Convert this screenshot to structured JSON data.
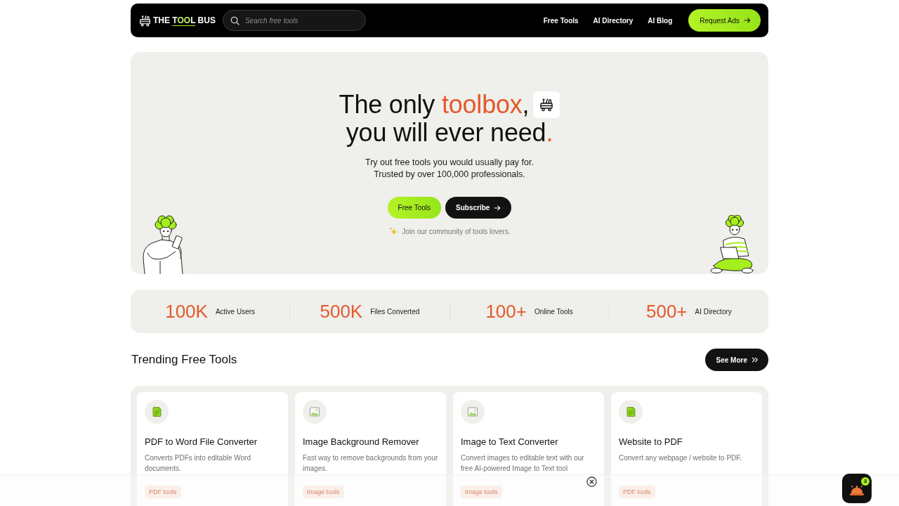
{
  "header": {
    "logo": [
      {
        "text": "THE ",
        "accent": false,
        "underline": false
      },
      {
        "text": "T",
        "accent": false,
        "underline": true
      },
      {
        "text": "OO",
        "accent": true,
        "underline": true
      },
      {
        "text": "L",
        "accent": false,
        "underline": true
      },
      {
        "text": " BUS",
        "accent": false,
        "underline": false
      }
    ],
    "search": {
      "placeholder": "Search free tools"
    },
    "nav": [
      "Free Tools",
      "AI Directory",
      "AI Blog"
    ],
    "cta": "Request Ads"
  },
  "hero": {
    "headline": [
      [
        {
          "text": "The only ",
          "accent": false
        },
        {
          "text": "toolbox",
          "accent": true
        },
        {
          "text": ",",
          "accent": false
        }
      ],
      [
        {
          "text": "you will ever need",
          "accent": false
        },
        {
          "text": ".",
          "accent": true
        }
      ]
    ],
    "subtitle": [
      "Try out free tools you would usually pay for.",
      "Trusted by over 100,000 professionals."
    ],
    "buttons": [
      {
        "label": "Free Tools",
        "kind": "primary"
      },
      {
        "label": "Subscribe",
        "kind": "secondary"
      }
    ],
    "community": "Join our community of tools lovers."
  },
  "stats": [
    {
      "value": "100K",
      "label": "Active Users"
    },
    {
      "value": "500K",
      "label": "Files Converted"
    },
    {
      "value": "100+",
      "label": "Online Tools"
    },
    {
      "value": "500+",
      "label": "AI Directory"
    }
  ],
  "trending": {
    "title": "Trending Free Tools",
    "see_more": "See More",
    "tools": [
      {
        "kind": "document",
        "title": "PDF to Word File Converter",
        "description": "Converts PDFs into editable Word documents.",
        "tag": "PDF tools"
      },
      {
        "kind": "image",
        "title": "Image Background Remover",
        "description": "Fast way to remove backgrounds from your images.",
        "tag": "Image tools"
      },
      {
        "kind": "image",
        "title": "Image to Text Converter",
        "description": "Convert images to editable text with our free AI-powered Image to Text tool",
        "tag": "Image tools"
      },
      {
        "kind": "document",
        "title": "Website to PDF",
        "description": "Convert any webpage / website to PDF.",
        "tag": "PDF tools"
      }
    ]
  },
  "notification_widget": {
    "badge": "3"
  }
}
